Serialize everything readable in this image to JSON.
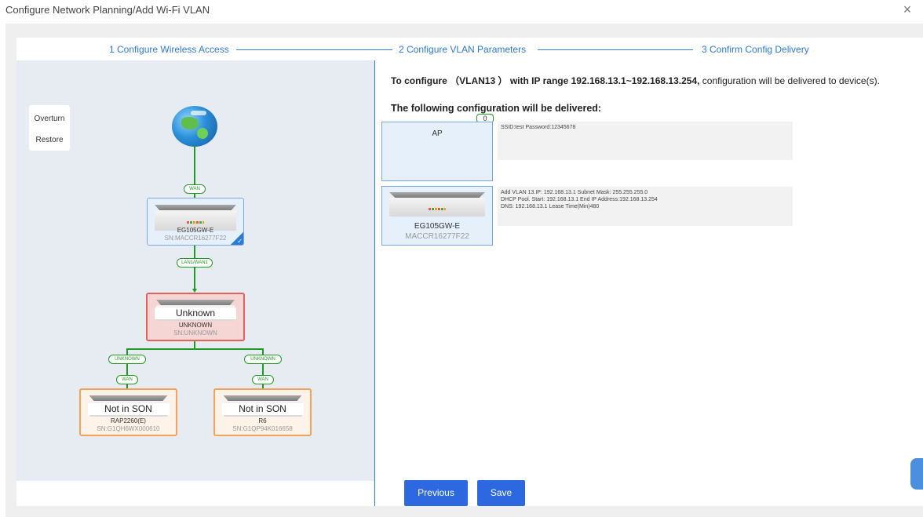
{
  "window": {
    "title": "Configure Network Planning/Add Wi-Fi VLAN",
    "close_glyph": "×"
  },
  "steps": [
    {
      "label": "1 Configure Wireless Access"
    },
    {
      "label": "2 Configure VLAN Parameters"
    },
    {
      "label": "3 Confirm Config Delivery"
    }
  ],
  "topology": {
    "side_buttons": {
      "overturn": "Overturn",
      "restore": "Restore"
    },
    "links": {
      "wan_top": "WAN",
      "lan1_wan1": "LAN1/WAN1",
      "unknown_left": "UNKNOWN",
      "unknown_right": "UNKNOWN",
      "wan_left": "WAN",
      "wan_right": "WAN"
    },
    "gateway": {
      "model": "EG105GW-E",
      "sn": "SN:MACCR16277F22",
      "selected": true
    },
    "switch": {
      "status": "Unknown",
      "model": "UNKNOWN",
      "sn": "SN:UNKNOWN"
    },
    "ap_left": {
      "status": "Not in SON",
      "model": "RAP2260(E)",
      "sn": "SN:G1QH6WX000610"
    },
    "ap_right": {
      "status": "Not in SON",
      "model": "R6",
      "sn": "SN:G1QP94K016658"
    }
  },
  "summary": {
    "prefix": "To configure",
    "vlan": "（VLAN13 ）",
    "ip_part": "with IP range 192.168.13.1~192.168.13.254,",
    "suffix": "configuration will be delivered to device(s).",
    "deliver_title": "The following configuration will be delivered:"
  },
  "delivery": {
    "ap_badge": "0",
    "ap_label": "AP",
    "ap_config": "SSID:test Password:12345678",
    "gateway_model": "EG105GW-E",
    "gateway_sn": "MACCR16277F22",
    "gateway_config_1": "Add VLAN 13.IP: 192.168.13.1 Subnet Mask: 255.255.255.0",
    "gateway_config_2": "DHCP Pool. Start: 192.168.13.1 End IP Address:192.168.13.254",
    "gateway_config_3": "DNS: 192.168.13.1 Lease Time(Min)480"
  },
  "buttons": {
    "previous": "Previous",
    "save": "Save"
  },
  "colors": {
    "accent": "#2d68e0",
    "link_green": "#1f9b24",
    "error_red": "#e0625a",
    "warn_orange": "#f3a35a"
  }
}
